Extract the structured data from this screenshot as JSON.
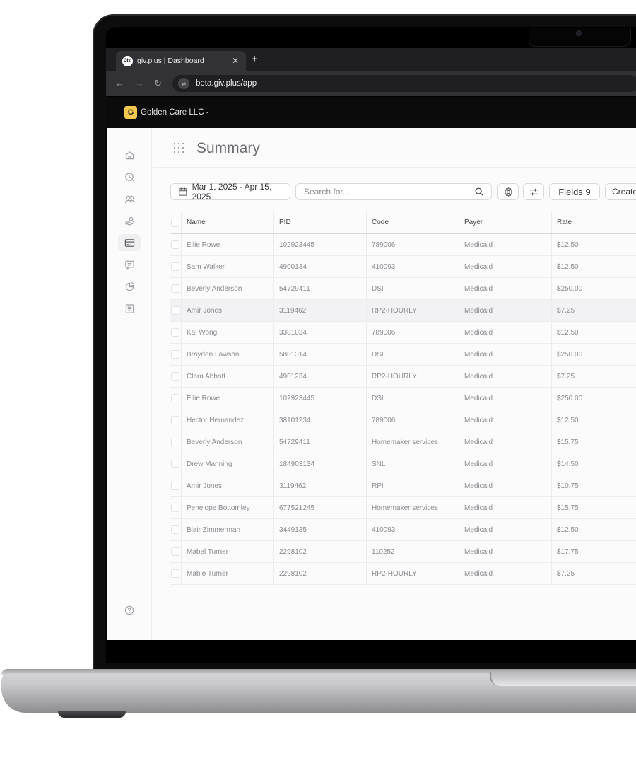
{
  "browser": {
    "tab_title": "giv.plus | Dashboard",
    "favicon_text": "Giv.",
    "url": "beta.giv.plus/app"
  },
  "org": {
    "initial": "G",
    "name": "Golden Care LLC"
  },
  "page": {
    "title": "Summary"
  },
  "toolbar": {
    "date_range": "Mar 1, 2025 - Apr 15, 2025",
    "search_placeholder": "Search for...",
    "fields_label": "Fields 9",
    "create_label": "Create"
  },
  "sidebar": {
    "icons": [
      "home-icon",
      "clock-icon",
      "users-icon",
      "caregiver-icon",
      "billing-icon",
      "message-icon",
      "pie-chart-icon",
      "notes-icon"
    ],
    "active_index": 4
  },
  "table": {
    "headers": [
      "Name",
      "PID",
      "Code",
      "Payer",
      "Rate"
    ],
    "rows": [
      [
        "Ellie Rowe",
        "102923445",
        "789006",
        "Medicaid",
        "$12.50"
      ],
      [
        "Sam Walker",
        "4900134",
        "410093",
        "Medicaid",
        "$12.50"
      ],
      [
        "Beverly Anderson",
        "54729411",
        "DSI",
        "Medicaid",
        "$250.00"
      ],
      [
        "Amir Jones",
        "3119462",
        "RP2-HOURLY",
        "Medicaid",
        "$7.25"
      ],
      [
        "Kai Wong",
        "3381034",
        "789006",
        "Medicaid",
        "$12.50"
      ],
      [
        "Brayden Lawson",
        "5801314",
        "DSI",
        "Medicaid",
        "$250.00"
      ],
      [
        "Clara Abbott",
        "4901234",
        "RP2-HOURLY",
        "Medicaid",
        "$7.25"
      ],
      [
        "Ellie Rowe",
        "102923445",
        "DSI",
        "Medicaid",
        "$250.00"
      ],
      [
        "Hector Hernandez",
        "38101234",
        "789006",
        "Medicaid",
        "$12.50"
      ],
      [
        "Beverly Anderson",
        "54729411",
        "Homemaker services",
        "Medicaid",
        "$15.75"
      ],
      [
        "Drew Manning",
        "184903134",
        "SNL",
        "Medicaid",
        "$14.50"
      ],
      [
        "Amir Jones",
        "3119462",
        "RPI",
        "Medicaid",
        "$10.75"
      ],
      [
        "Penelope Bottomley",
        "677521245",
        "Homemaker services",
        "Medicaid",
        "$15.75"
      ],
      [
        "Blair Zimmerman",
        "3449135",
        "410093",
        "Medicaid",
        "$12.50"
      ],
      [
        "Mabel Turner",
        "2298102",
        "110252",
        "Medicaid",
        "$17.75"
      ],
      [
        "Mable Turner",
        "2298102",
        "RP2-HOURLY",
        "Medicaid",
        "$7.25"
      ]
    ],
    "highlighted_row": 3
  }
}
